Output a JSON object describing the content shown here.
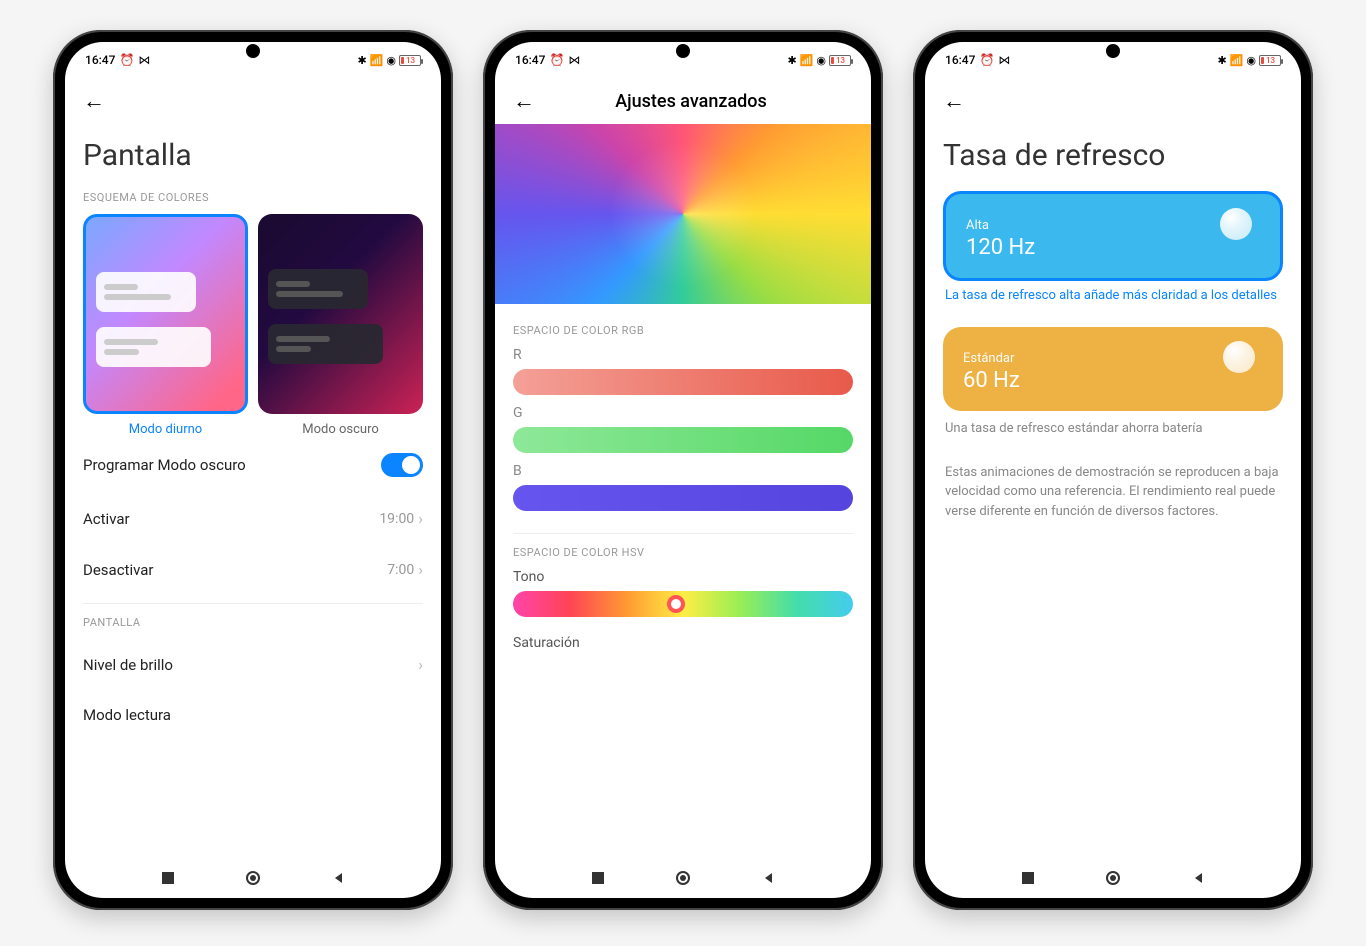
{
  "status": {
    "time": "16:47",
    "icons_left": [
      "alarm-icon",
      "cast-icon"
    ],
    "icons_right": [
      "bluetooth-icon",
      "signal-icon",
      "signal-icon",
      "wifi-icon"
    ],
    "battery": "13"
  },
  "phone1": {
    "title": "Pantalla",
    "section_scheme": "ESQUEMA DE COLORES",
    "mode_light": "Modo diurno",
    "mode_dark": "Modo oscuro",
    "schedule_label": "Programar Modo oscuro",
    "schedule_on": true,
    "activate_label": "Activar",
    "activate_value": "19:00",
    "deactivate_label": "Desactivar",
    "deactivate_value": "7:00",
    "section_display": "PANTALLA",
    "brightness": "Nivel de brillo",
    "reading": "Modo lectura"
  },
  "phone2": {
    "header": "Ajustes avanzados",
    "section_rgb": "ESPACIO DE COLOR RGB",
    "r": "R",
    "g": "G",
    "b": "B",
    "section_hsv": "ESPACIO DE COLOR HSV",
    "tone": "Tono",
    "saturation": "Saturación"
  },
  "phone3": {
    "title": "Tasa de refresco",
    "high_label": "Alta",
    "high_value": "120 Hz",
    "high_caption": "La tasa de refresco alta añade más claridad a los detalles",
    "std_label": "Estándar",
    "std_value": "60 Hz",
    "std_caption": "Una tasa de refresco estándar ahorra batería",
    "footnote": "Estas animaciones de demostración se reproducen a baja velocidad como una referencia. El rendimiento real puede verse diferente en función de diversos factores."
  }
}
